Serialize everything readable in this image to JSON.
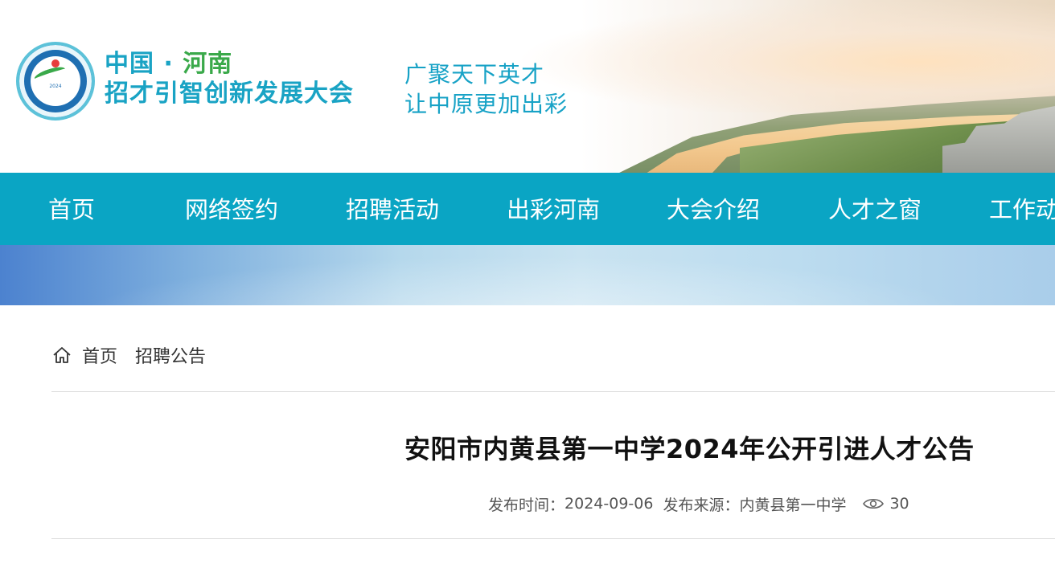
{
  "header": {
    "logo_alt": "logo",
    "logo_mini_text": "2024",
    "brand_line1_a": "中国",
    "brand_line1_b": " · ",
    "brand_line1_c": "河南",
    "brand_line2": "招才引智创新发展大会",
    "slogan_line1": "广聚天下英才",
    "slogan_line2": "让中原更加出彩"
  },
  "nav": {
    "items": [
      {
        "label": "首页"
      },
      {
        "label": "网络签约"
      },
      {
        "label": "招聘活动"
      },
      {
        "label": "出彩河南"
      },
      {
        "label": "大会介绍"
      },
      {
        "label": "人才之窗"
      },
      {
        "label": "工作动"
      }
    ]
  },
  "breadcrumb": {
    "home": "首页",
    "current": "招聘公告"
  },
  "article": {
    "title": "安阳市内黄县第一中学2024年公开引进人才公告",
    "publish_label": "发布时间：",
    "publish_date": "2024-09-06",
    "source_label": "发布来源：",
    "source": "内黄县第一中学",
    "views": "30"
  },
  "colors": {
    "nav_bg": "#0aa5c4",
    "brand_blue": "#19a3c4",
    "brand_green": "#3aa94a"
  }
}
